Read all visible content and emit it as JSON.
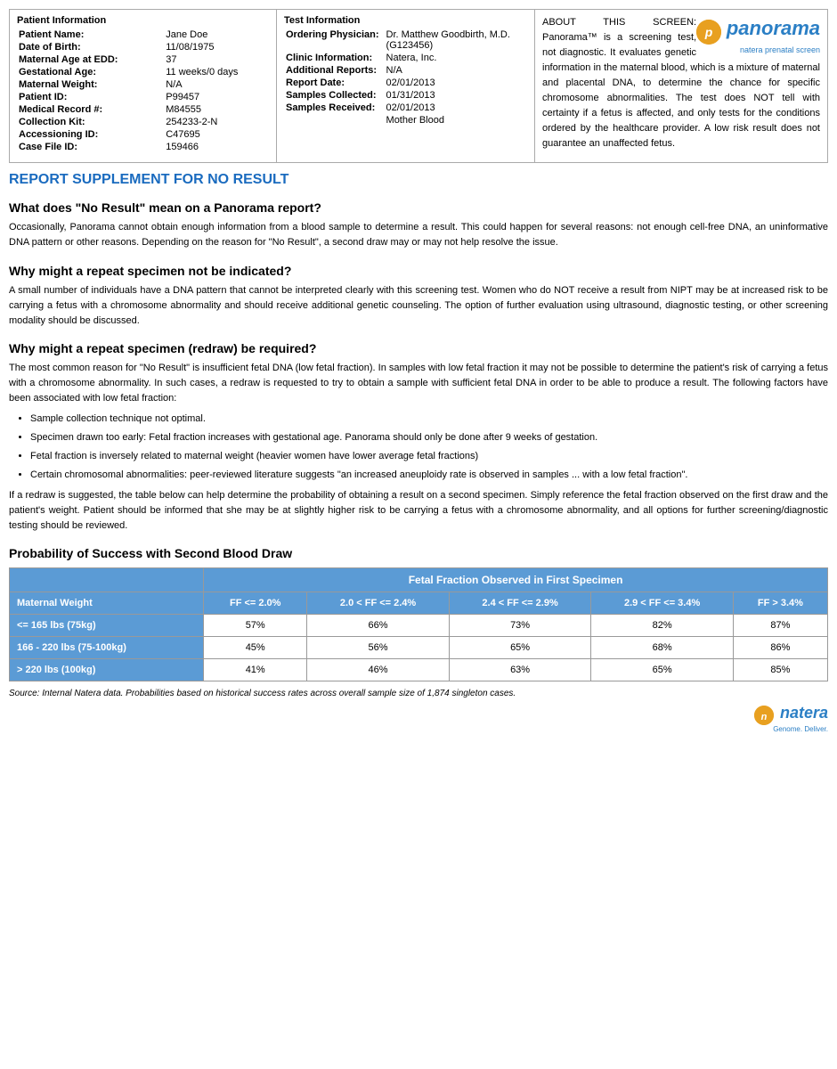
{
  "patient_info": {
    "section_title": "Patient Information",
    "fields": [
      {
        "label": "Patient Name:",
        "value": "Jane Doe"
      },
      {
        "label": "Date of Birth:",
        "value": "11/08/1975"
      },
      {
        "label": "Maternal Age at EDD:",
        "value": "37"
      },
      {
        "label": "Gestational Age:",
        "value": "11 weeks/0 days"
      },
      {
        "label": "Maternal Weight:",
        "value": "N/A"
      },
      {
        "label": "Patient ID:",
        "value": "P99457"
      },
      {
        "label": "Medical Record #:",
        "value": "M84555"
      },
      {
        "label": "Collection Kit:",
        "value": "254233-2-N"
      },
      {
        "label": "Accessioning ID:",
        "value": "C47695"
      },
      {
        "label": "Case File ID:",
        "value": "159466"
      }
    ]
  },
  "test_info": {
    "section_title": "Test Information",
    "fields": [
      {
        "label": "Ordering Physician:",
        "value": "Dr. Matthew Goodbirth, M.D. (G123456)"
      },
      {
        "label": "Clinic Information:",
        "value": "Natera, Inc."
      },
      {
        "label": "Additional Reports:",
        "value": "N/A"
      },
      {
        "label": "Report Date:",
        "value": "02/01/2013"
      },
      {
        "label": "Samples Collected:",
        "value": "01/31/2013"
      },
      {
        "label": "Samples Received:",
        "value": "02/01/2013"
      },
      {
        "label": "collection_note",
        "value": "Mother Blood"
      }
    ]
  },
  "about": {
    "text": "ABOUT THIS SCREEN: Panorama™ is a screening test, not diagnostic. It evaluates genetic information in the maternal blood, which is a mixture of maternal and placental DNA, to determine the chance for specific chromosome abnormalities. The test does NOT tell with certainty if a fetus is affected, and only tests for the conditions ordered by the healthcare provider. A low risk result does not guarantee an unaffected fetus."
  },
  "logo": {
    "brand": "panorama",
    "sub": "natera prenatal screen"
  },
  "report": {
    "supplement_title": "REPORT SUPPLEMENT for NO RESULT",
    "q1_heading": "What does \"No Result\" mean on a Panorama report?",
    "q1_body": "Occasionally, Panorama cannot obtain enough information from a blood sample to determine a result. This could happen for several reasons: not enough cell-free DNA, an uninformative DNA pattern or other reasons. Depending on the reason for \"No Result\", a second draw may or may not help resolve the issue.",
    "q2_heading": "Why might a repeat specimen not be indicated?",
    "q2_body": "A small number of individuals have a DNA pattern that cannot be interpreted clearly with this screening test. Women who do NOT receive a result from NIPT may be at increased risk to be carrying a fetus with a chromosome abnormality and should receive additional genetic counseling. The option of further evaluation using ultrasound, diagnostic testing, or other screening modality should be discussed.",
    "q3_heading": "Why might a repeat specimen (redraw) be required?",
    "q3_body": "The most common reason for \"No Result\" is insufficient fetal DNA (low fetal fraction). In samples with low fetal fraction it may not be possible to determine the patient's risk of carrying a fetus with a chromosome abnormality. In such cases, a redraw is requested to try to obtain a sample with sufficient fetal DNA in order to be able to produce a result. The following factors have been associated with low fetal fraction:",
    "bullets": [
      "Sample collection technique not optimal.",
      "Specimen drawn too early: Fetal fraction increases with gestational age. Panorama should only be done after 9 weeks of gestation.",
      "Fetal fraction is inversely related to maternal weight (heavier women have lower average fetal fractions)",
      "Certain chromosomal abnormalities: peer-reviewed literature suggests \"an increased aneuploidy rate is observed in samples ... with a low fetal fraction\"."
    ],
    "redraw_body": "If a redraw is suggested, the table below can help determine the probability of obtaining a result on a second specimen. Simply reference the fetal fraction observed on the first draw and the patient's weight. Patient should be informed that she may be at slightly higher risk to be carrying a fetus with a chromosome abnormality, and all options for further screening/diagnostic testing should be reviewed.",
    "prob_title": "Probability of Success with Second Blood Draw",
    "prob_table": {
      "main_header": "Fetal Fraction Observed in First Specimen",
      "col_headers": [
        "Maternal Weight",
        "FF <= 2.0%",
        "2.0 < FF <= 2.4%",
        "2.4 < FF <= 2.9%",
        "2.9 < FF <= 3.4%",
        "FF > 3.4%"
      ],
      "rows": [
        {
          "weight": "<= 165 lbs (75kg)",
          "values": [
            "57%",
            "66%",
            "73%",
            "82%",
            "87%"
          ]
        },
        {
          "weight": "166 - 220 lbs (75-100kg)",
          "values": [
            "45%",
            "56%",
            "65%",
            "68%",
            "86%"
          ]
        },
        {
          "weight": "> 220 lbs (100kg)",
          "values": [
            "41%",
            "46%",
            "63%",
            "65%",
            "85%"
          ]
        }
      ]
    },
    "source_text": "Source: Internal Natera data. Probabilities based on historical success rates across overall sample size of 1,874 singleton cases."
  },
  "footer": {
    "brand": "natera",
    "sub": "Genome. Deliver."
  }
}
